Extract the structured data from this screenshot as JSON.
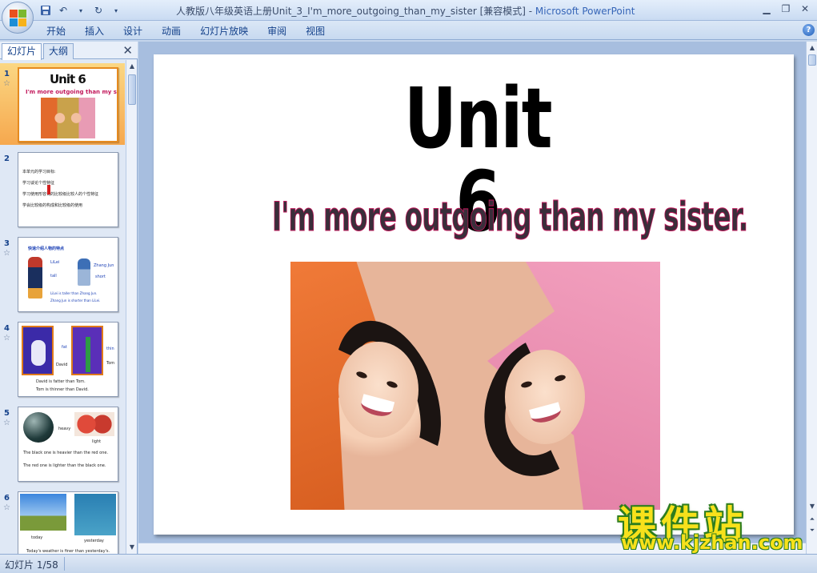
{
  "window": {
    "title_doc": "人教版八年级英语上册Unit_3_I'm_more_outgoing_than_my_sister [兼容模式] - ",
    "title_app": "Microsoft PowerPoint"
  },
  "ribbon": {
    "tabs": [
      "开始",
      "插入",
      "设计",
      "动画",
      "幻灯片放映",
      "审阅",
      "视图"
    ]
  },
  "left_pane": {
    "tabs": [
      "幻灯片",
      "大纲"
    ],
    "slides": [
      {
        "num": "1",
        "title": "Unit 6",
        "subtitle": "I'm more outgoing than my sister."
      },
      {
        "num": "2",
        "lines": [
          "本单元的学习目标:",
          "学习谈论个性特征",
          "学习使用形容词的比较级比较人的个性特征",
          "学会比较级的构成和比较级的使用"
        ]
      },
      {
        "num": "3",
        "lines": [
          "快速介绍人物的特点",
          "LiLei",
          "Zhang Jun",
          "tall",
          "short",
          "LiLei is taller than Zhang Jun.",
          "Zhang Jun is shorter than LiLei."
        ]
      },
      {
        "num": "4",
        "lines": [
          "fat",
          "thin",
          "David",
          "Tom",
          "David is fatter than Tom.",
          "Tom is thinner than David."
        ]
      },
      {
        "num": "5",
        "lines": [
          "heavy",
          "light",
          "The black one is heavier than the red one.",
          "The red one is lighter than the black one."
        ]
      },
      {
        "num": "6",
        "lines": [
          "today",
          "yesterday",
          "Today's weather is finer than yesterday's."
        ]
      }
    ]
  },
  "slide": {
    "title": "Unit 6",
    "subtitle": "I'm more outgoing than my sister."
  },
  "watermark": {
    "cn": "课件站",
    "url": "www.kjzhan.com"
  },
  "status": {
    "slide_counter": "幻灯片 1/58"
  }
}
